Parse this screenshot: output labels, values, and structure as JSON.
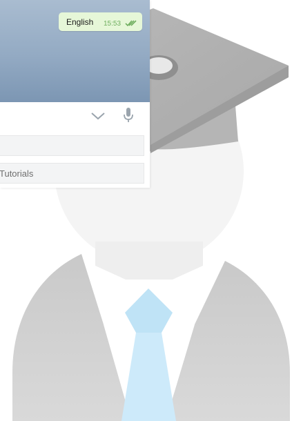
{
  "chat": {
    "message": {
      "text": "English",
      "time": "15:53",
      "status": "double-check-read"
    }
  },
  "input_bar": {
    "icons": [
      "chevron-down-icon",
      "microphone-icon"
    ]
  },
  "keyboard": {
    "buttons": [
      {
        "label": ""
      },
      {
        "label": "Tutorials"
      }
    ]
  },
  "colors": {
    "chat_background": "#93aac3",
    "bubble_background": "#e6f7d8",
    "time_text": "#6fae5f",
    "keyboard_button": "#f3f4f5",
    "tie": "#cdeafa"
  }
}
